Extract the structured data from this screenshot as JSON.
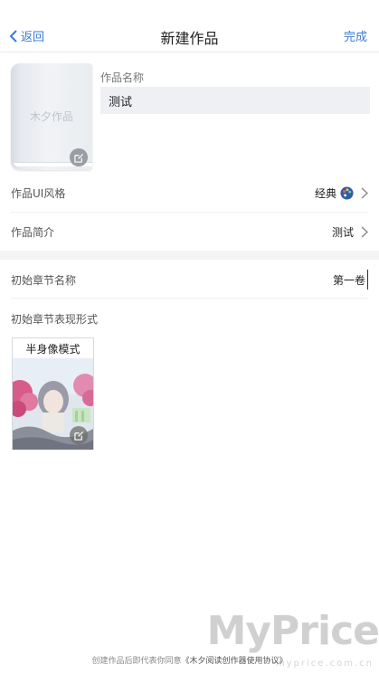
{
  "nav": {
    "back_label": "返回",
    "title": "新建作品",
    "done_label": "完成",
    "accent_color": "#3a7bd5"
  },
  "cover": {
    "placeholder_text": "木夕作品",
    "edit_icon": "edit-icon"
  },
  "work_name": {
    "label": "作品名称",
    "value": "测试"
  },
  "ui_style": {
    "label": "作品UI风格",
    "value": "经典",
    "icon": "palette-icon"
  },
  "intro": {
    "label": "作品简介",
    "value": "测试"
  },
  "chapter": {
    "label": "初始章节名称",
    "value": "第一卷"
  },
  "mode": {
    "section_label": "初始章节表现形式",
    "card_title": "半身像模式"
  },
  "footer": {
    "text": "创建作品后即代表你同意",
    "link": "《木夕阅读创作器使用协议》"
  },
  "watermark": {
    "text": "MyPrice",
    "sub": "myprice.com.cn"
  }
}
